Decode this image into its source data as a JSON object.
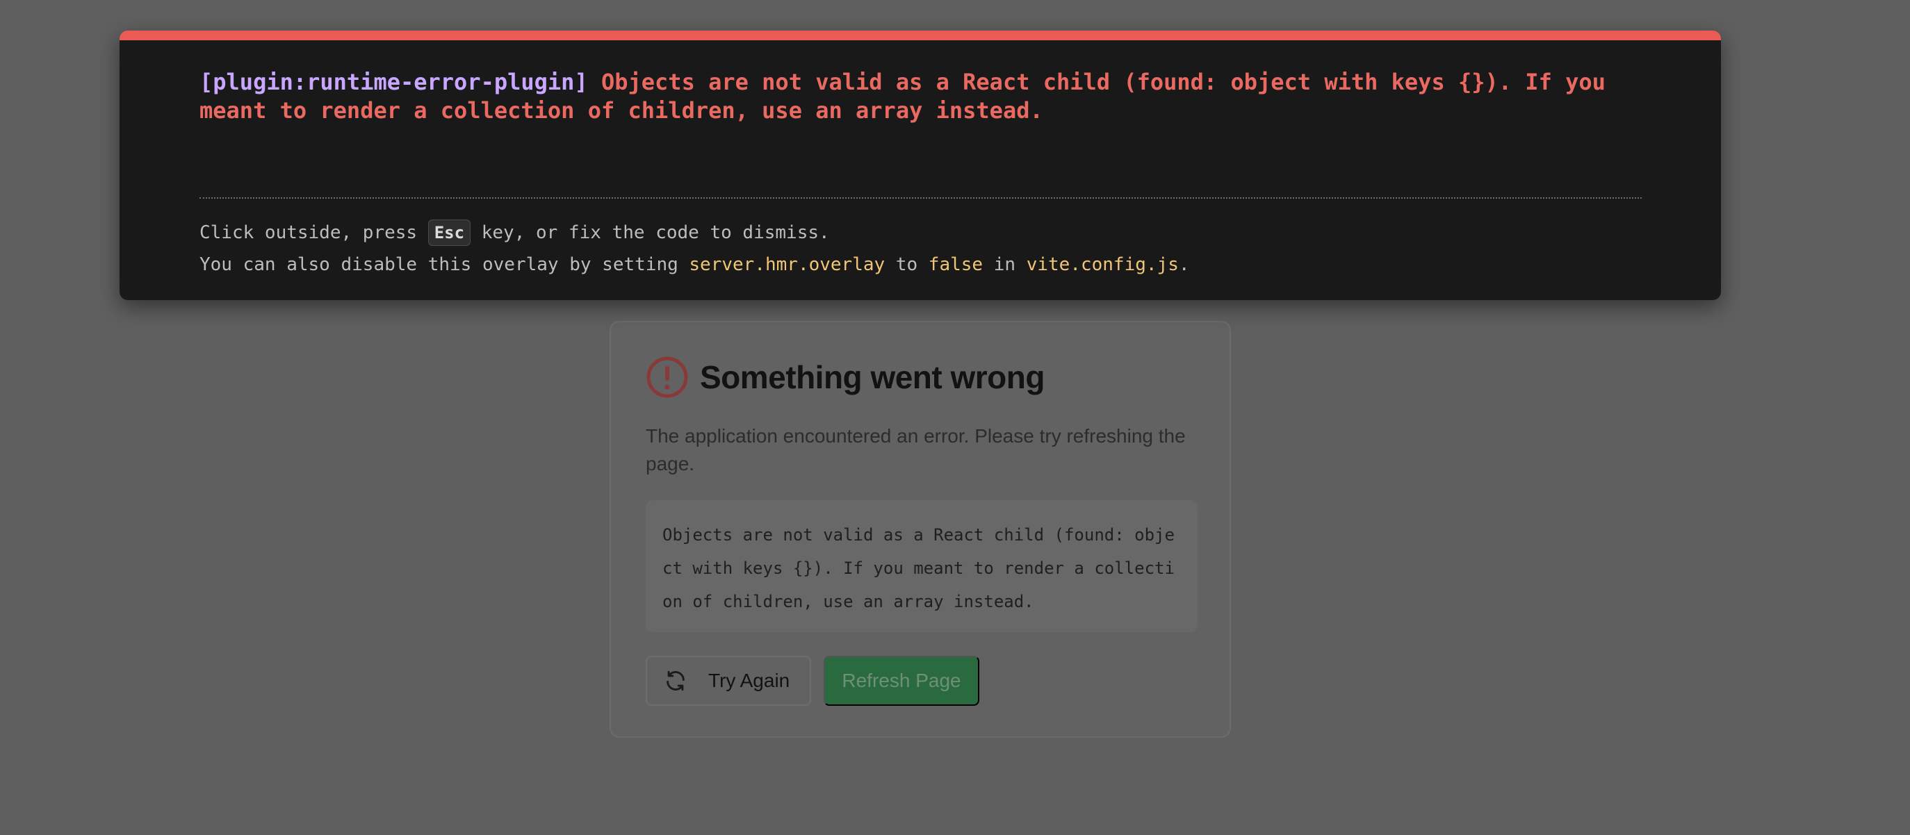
{
  "overlay": {
    "plugin_tag": "[plugin:runtime-error-plugin]",
    "message": "Objects are not valid as a React child (found: object with keys {}). If you meant to render a collection of children, use an array instead.",
    "tip_1_before": "Click outside, press ",
    "tip_1_key": "Esc",
    "tip_1_after": " key, or fix the code to dismiss.",
    "tip_2_part1": "You can also disable this overlay by setting ",
    "tip_2_code1": "server.hmr.overlay",
    "tip_2_part2": " to ",
    "tip_2_code2": "false",
    "tip_2_part3": " in ",
    "tip_2_code3": "vite.config.js",
    "tip_2_part4": ".",
    "accent_color": "#ea5b55"
  },
  "error_card": {
    "icon": "alert-circle-icon",
    "title": "Something went wrong",
    "description": "The application encountered an error. Please try refreshing the page.",
    "error_text": "Objects are not valid as a React child (found: object with keys {}). If you meant to render a collection of children, use an array instead.",
    "try_again_label": "Try Again",
    "try_again_icon": "refresh-icon",
    "refresh_label": "Refresh Page",
    "primary_color": "#2a6a3f"
  }
}
